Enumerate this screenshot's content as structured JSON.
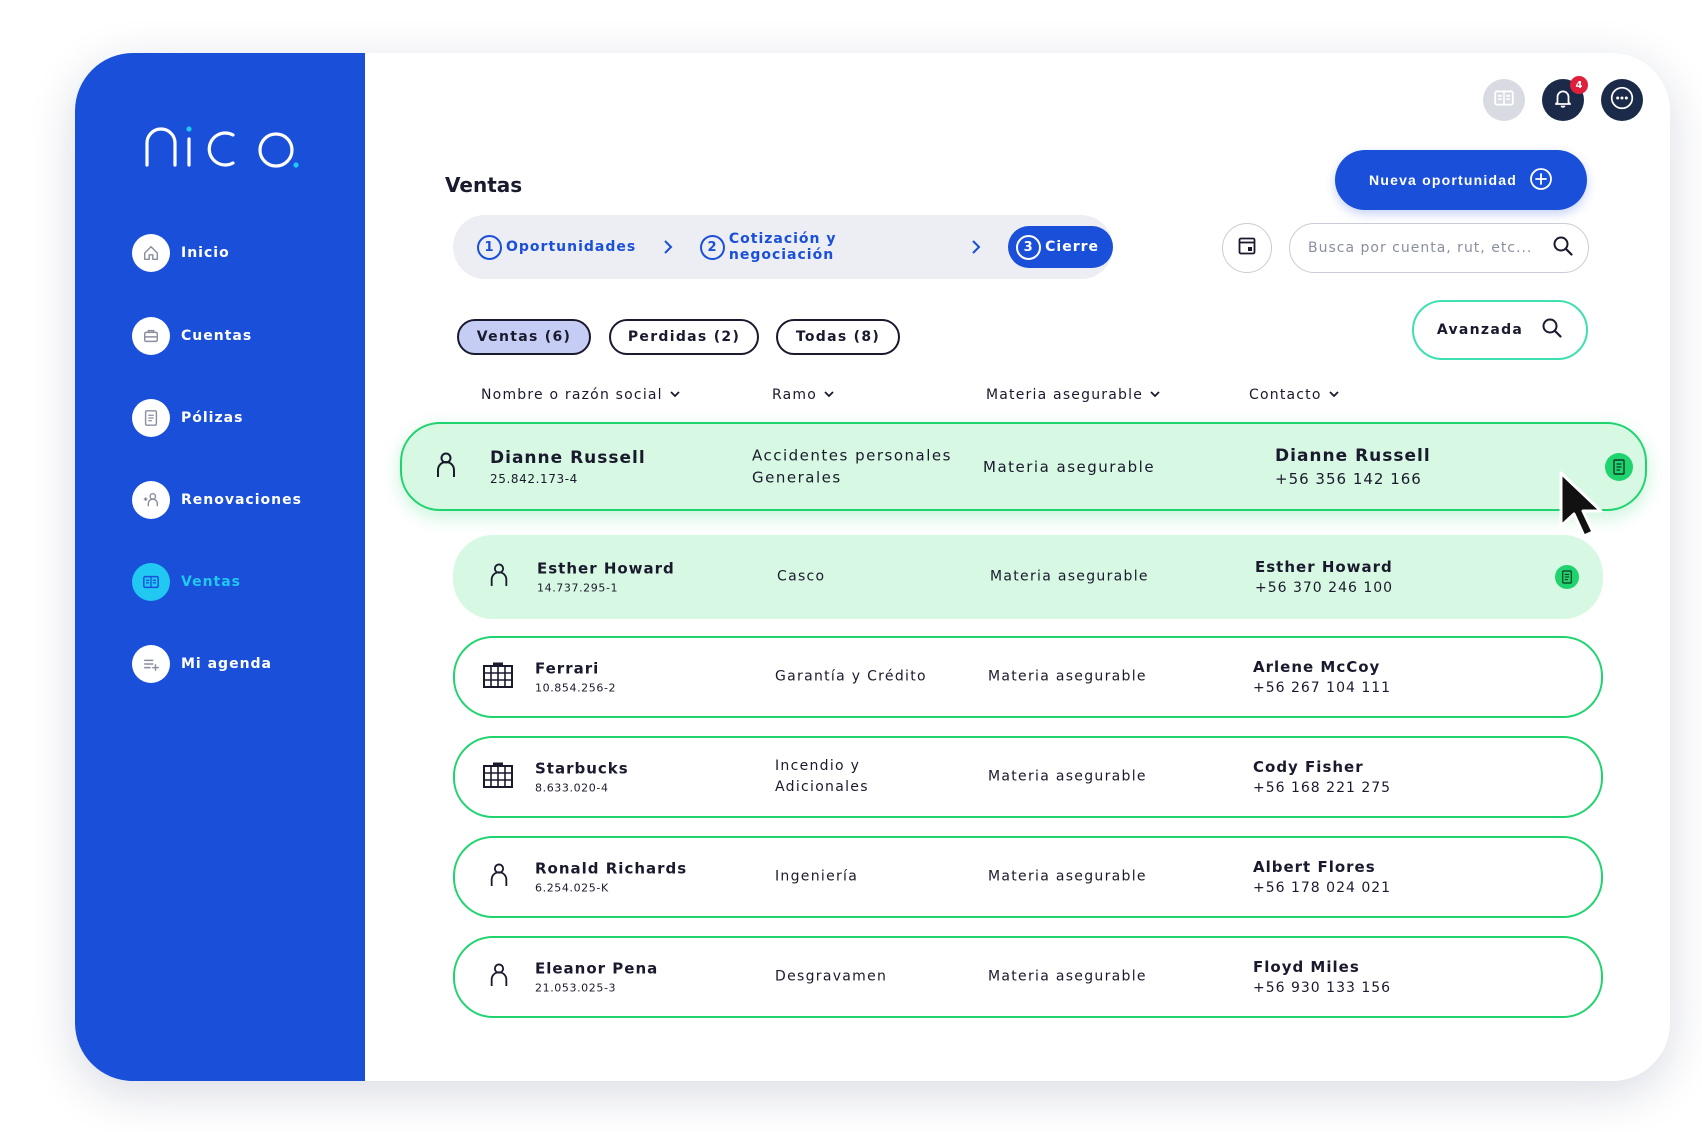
{
  "app": {
    "name": "nico"
  },
  "sidebar": {
    "items": [
      {
        "label": "Inicio",
        "icon": "home-icon"
      },
      {
        "label": "Cuentas",
        "icon": "briefcase-icon"
      },
      {
        "label": "Pólizas",
        "icon": "document-icon"
      },
      {
        "label": "Renovaciones",
        "icon": "user-refresh-icon"
      },
      {
        "label": "Ventas",
        "icon": "book-icon",
        "active": true
      },
      {
        "label": "Mi agenda",
        "icon": "add-list-icon"
      }
    ]
  },
  "topbar": {
    "notification_count": "4"
  },
  "page": {
    "title": "Ventas",
    "new_button": "Nueva oportunidad"
  },
  "stepper": {
    "steps": [
      {
        "number": "1",
        "label": "Oportunidades"
      },
      {
        "number": "2",
        "label": "Cotización y negociación"
      },
      {
        "number": "3",
        "label": "Cierre",
        "active": true
      }
    ]
  },
  "search": {
    "placeholder": "Busca por cuenta, rut, etc..."
  },
  "filters": [
    {
      "label": "Ventas (6)",
      "active": true
    },
    {
      "label": "Perdidas (2)"
    },
    {
      "label": "Todas (8)"
    }
  ],
  "advanced_button": "Avanzada",
  "columns": [
    "Nombre o razón social",
    "Ramo",
    "Materia asegurable",
    "Contacto"
  ],
  "rows": [
    {
      "type": "person",
      "name": "Dianne Russell",
      "id": "25.842.173-4",
      "ramo": "Accidentes personales Generales",
      "materia": "Materia asegurable",
      "contact_name": "Dianne Russell",
      "contact_phone": "+56 356 142 166",
      "doc": true
    },
    {
      "type": "person",
      "name": "Esther Howard",
      "id": "14.737.295-1",
      "ramo": "Casco",
      "materia": "Materia asegurable",
      "contact_name": "Esther Howard",
      "contact_phone": "+56 370 246 100",
      "doc": true
    },
    {
      "type": "company",
      "name": "Ferrari",
      "id": "10.854.256-2",
      "ramo": "Garantía y Crédito",
      "materia": "Materia asegurable",
      "contact_name": "Arlene McCoy",
      "contact_phone": "+56 267 104 111"
    },
    {
      "type": "company",
      "name": "Starbucks",
      "id": "8.633.020-4",
      "ramo": "Incendio y Adicionales",
      "materia": "Materia asegurable",
      "contact_name": "Cody Fisher",
      "contact_phone": "+56 168 221 275"
    },
    {
      "type": "person",
      "name": "Ronald Richards",
      "id": "6.254.025-K",
      "ramo": "Ingeniería",
      "materia": "Materia asegurable",
      "contact_name": "Albert Flores",
      "contact_phone": "+56 178 024 021"
    },
    {
      "type": "person",
      "name": "Eleanor Pena",
      "id": "21.053.025-3",
      "ramo": "Desgravamen",
      "materia": "Materia asegurable",
      "contact_name": "Floyd Miles",
      "contact_phone": "+56 930 133 156"
    }
  ],
  "colors": {
    "primary": "#1a4fd9",
    "accent_cyan": "#20c8f2",
    "row_border": "#1fd36f",
    "row_highlight": "#d7f8e2",
    "badge": "#e0203a"
  }
}
